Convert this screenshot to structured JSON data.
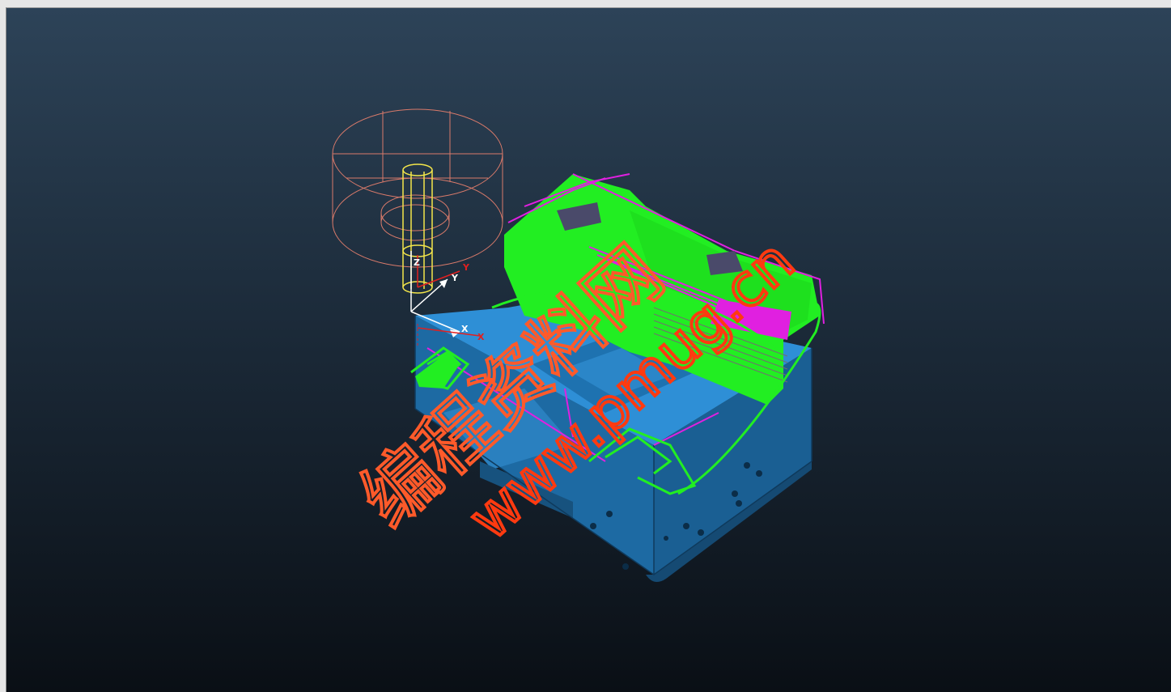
{
  "viewport": {
    "background_top": "#2d4358",
    "background_bottom": "#0a0f15"
  },
  "triad": {
    "z_label": "Z",
    "y_label": "Y",
    "x_label": "X",
    "y_label_red": "Y",
    "x_label_red": "X"
  },
  "watermark": {
    "cn_text": "编程资料网",
    "url_text": "www.pmug.cn",
    "color": "#ff5a2a"
  },
  "model_colors": {
    "block": "#1f6fa8",
    "block_top": "#2e8fd6",
    "toolpath_green": "#22ee22",
    "toolpath_magenta": "#e020e0",
    "tool_yellow": "#f4e64a",
    "holder_outline": "#d97a6a"
  }
}
